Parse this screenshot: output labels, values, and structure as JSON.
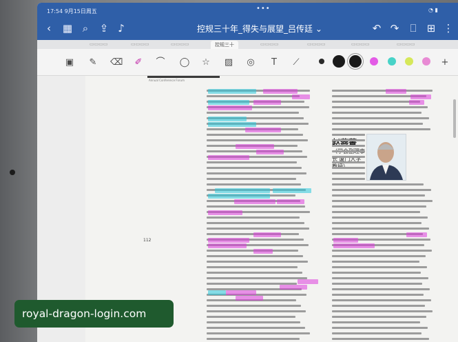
{
  "status_bar": {
    "time": "17:54",
    "date": "9月15日周五"
  },
  "document": {
    "title": "控规三十年_得失与展望_吕传廷",
    "chevron": "⌄"
  },
  "tabs": [
    {
      "label": "控规三十",
      "active": true
    }
  ],
  "page": {
    "author": {
      "name": "赵燕菁",
      "affiliation": "（学会副理事长  厦门大学教授）"
    },
    "page_number": "112",
    "header_text": "Annual Conference Forum"
  },
  "watermark": {
    "text": "royal-dragon-login.com"
  },
  "colors": {
    "titlebar": "#2f5fa8",
    "highlight_magenta": "#dc3cdc",
    "highlight_cyan": "#28c8dc",
    "swatch_magenta": "#e35be6",
    "swatch_teal": "#48d3c8",
    "swatch_yellow": "#d6e85a",
    "swatch_pink": "#e88ad4"
  }
}
